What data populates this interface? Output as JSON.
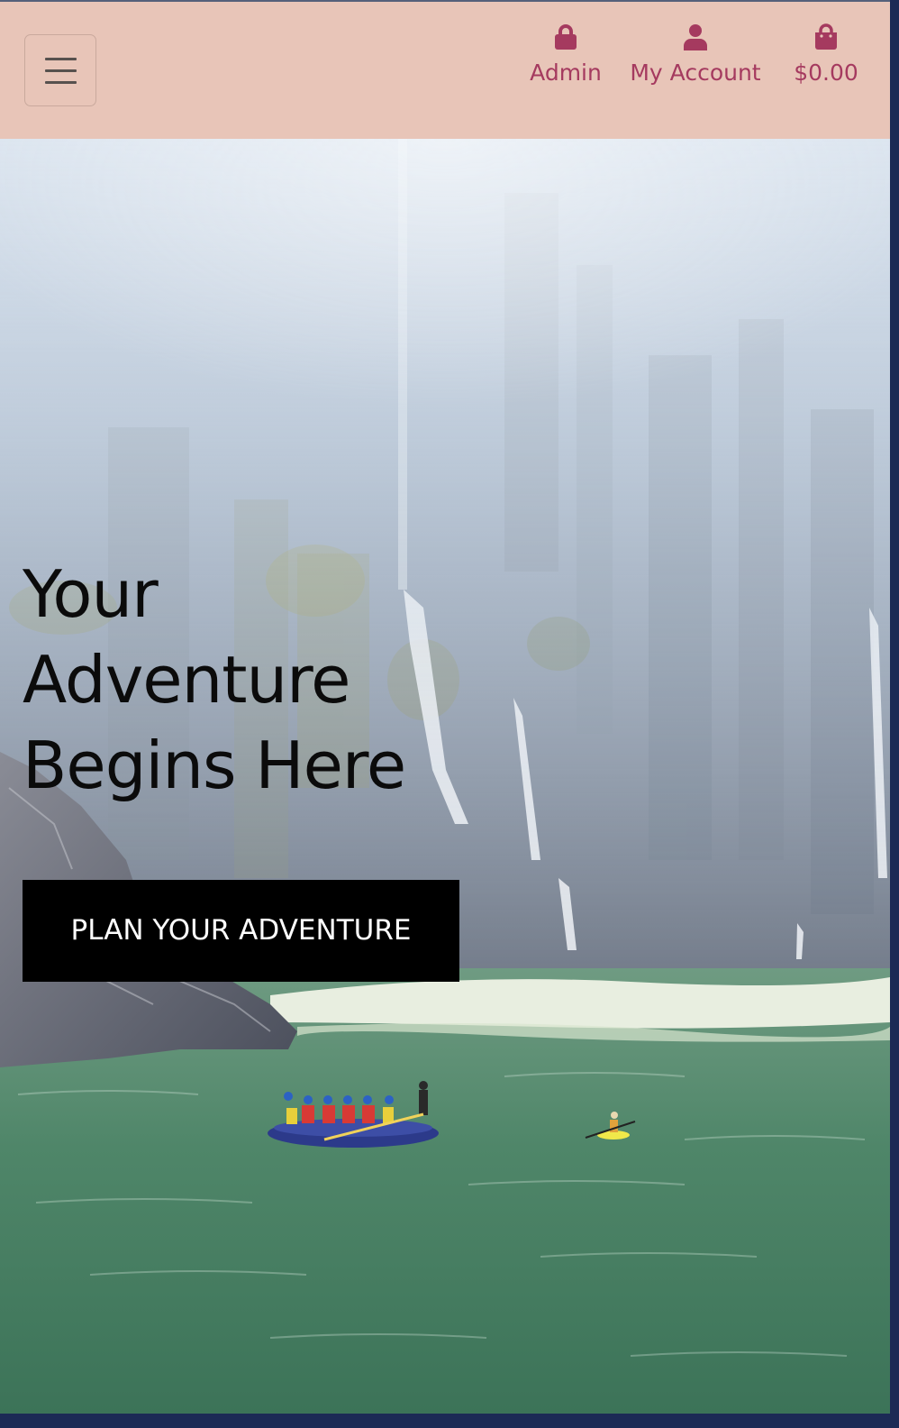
{
  "header": {
    "menu_toggle_icon": "hamburger-icon",
    "nav": [
      {
        "label": "Admin",
        "icon": "lock-icon"
      },
      {
        "label": "My Account",
        "icon": "user-icon"
      },
      {
        "label": "$0.00",
        "icon": "shopping-bag-icon"
      }
    ]
  },
  "hero": {
    "title_lines": [
      "Your",
      "Adventure",
      "Begins Here"
    ],
    "cta_label": "PLAN YOUR ADVENTURE",
    "image_subject": "rafting-on-river-below-waterfall-cliffs"
  },
  "colors": {
    "header_bg": "#e8c5b8",
    "nav_accent": "#a53a5f",
    "cta_bg": "#000000",
    "cta_text": "#ffffff"
  }
}
